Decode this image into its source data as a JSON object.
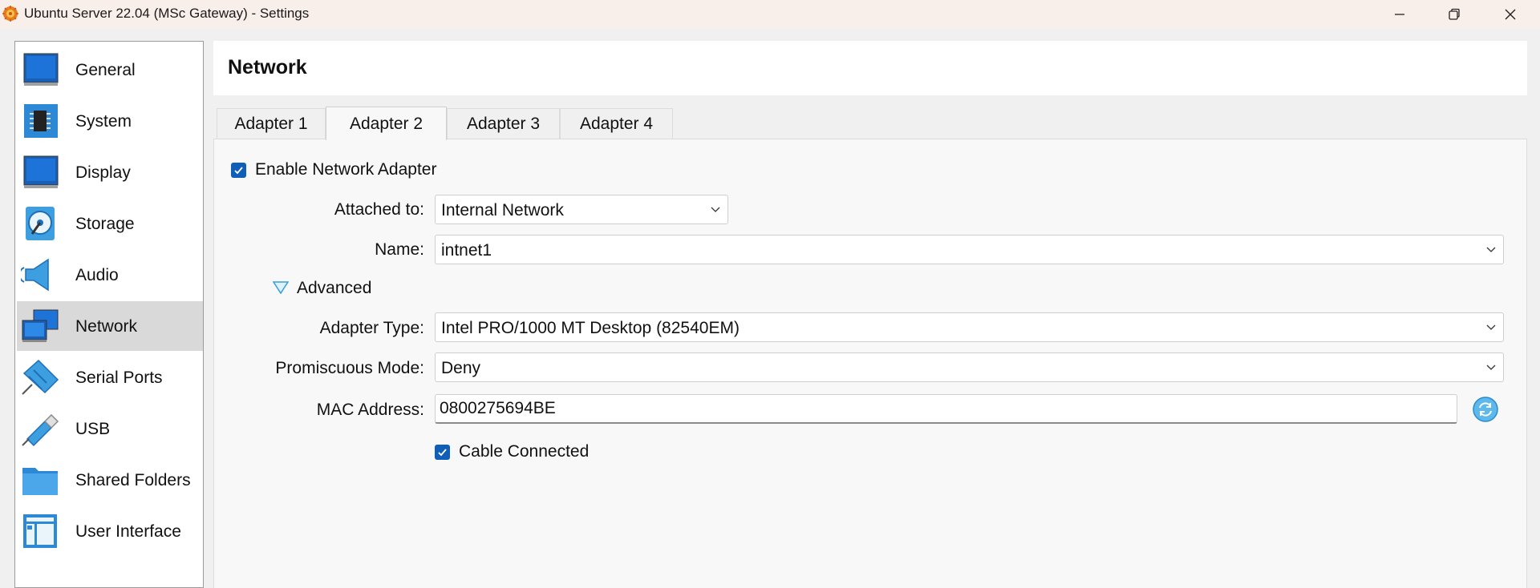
{
  "window": {
    "title": "Ubuntu Server 22.04 (MSc Gateway) - Settings",
    "controls": [
      "minimize",
      "restore",
      "close"
    ]
  },
  "sidebar": {
    "items": [
      {
        "label": "General",
        "icon": "general-icon"
      },
      {
        "label": "System",
        "icon": "system-chip-icon"
      },
      {
        "label": "Display",
        "icon": "display-monitor-icon"
      },
      {
        "label": "Storage",
        "icon": "storage-disk-icon"
      },
      {
        "label": "Audio",
        "icon": "audio-speaker-icon"
      },
      {
        "label": "Network",
        "icon": "network-icon",
        "selected": true
      },
      {
        "label": "Serial Ports",
        "icon": "serial-port-icon"
      },
      {
        "label": "USB",
        "icon": "usb-icon"
      },
      {
        "label": "Shared Folders",
        "icon": "folder-icon"
      },
      {
        "label": "User Interface",
        "icon": "user-interface-icon"
      }
    ]
  },
  "page": {
    "title": "Network"
  },
  "tabs": [
    {
      "label": "Adapter 1",
      "active": false
    },
    {
      "label": "Adapter 2",
      "active": true
    },
    {
      "label": "Adapter 3",
      "active": false
    },
    {
      "label": "Adapter 4",
      "active": false
    }
  ],
  "adapter": {
    "enable_label": "Enable Network Adapter",
    "enable_checked": true,
    "attached_label": "Attached to:",
    "attached_value": "Internal Network",
    "name_label": "Name:",
    "name_value": "intnet1",
    "advanced_label": "Advanced",
    "advanced_expanded": true,
    "adapter_type_label": "Adapter Type:",
    "adapter_type_value": "Intel PRO/1000 MT Desktop (82540EM)",
    "promiscuous_label": "Promiscuous Mode:",
    "promiscuous_value": "Deny",
    "mac_label": "MAC Address:",
    "mac_value": "0800275694BE",
    "cable_label": "Cable Connected",
    "cable_checked": true
  },
  "colors": {
    "accent": "#0f5fb8",
    "selected_bg": "#d9d9d9",
    "titlebar_bg": "#f9efea"
  }
}
